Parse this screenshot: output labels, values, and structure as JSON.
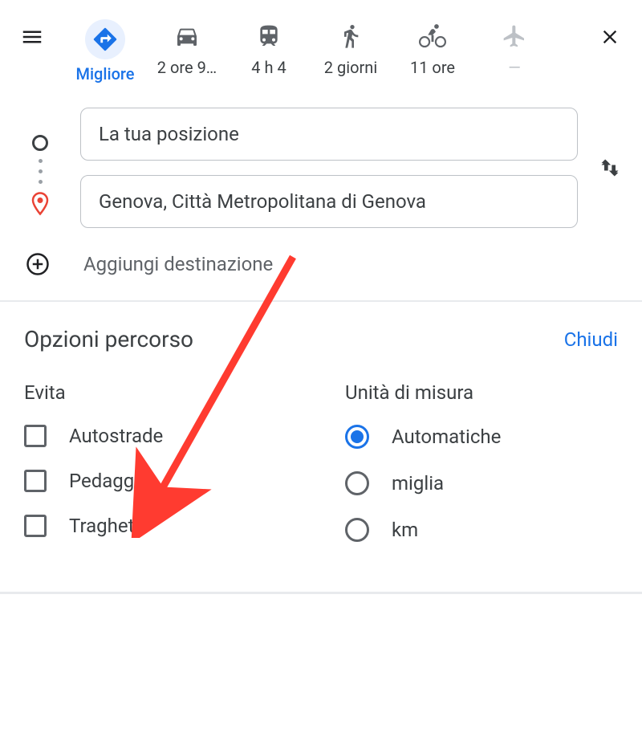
{
  "modes": {
    "best": {
      "label": "Migliore"
    },
    "car": {
      "label": "2 ore 9…"
    },
    "transit": {
      "label": "4 h 4"
    },
    "walk": {
      "label": "2 giorni"
    },
    "bike": {
      "label": "11 ore"
    },
    "plane": {
      "label": "—"
    }
  },
  "route": {
    "origin": "La tua posizione",
    "destination": "Genova, Città Metropolitana di Genova",
    "add_label": "Aggiungi destinazione"
  },
  "options": {
    "title": "Opzioni percorso",
    "close": "Chiudi",
    "avoid": {
      "title": "Evita",
      "items": {
        "highways": "Autostrade",
        "tolls": "Pedaggi",
        "ferries": "Traghetti"
      }
    },
    "units": {
      "title": "Unità di misura",
      "items": {
        "auto": "Automatiche",
        "miles": "miglia",
        "km": "km"
      },
      "selected": "auto"
    }
  }
}
